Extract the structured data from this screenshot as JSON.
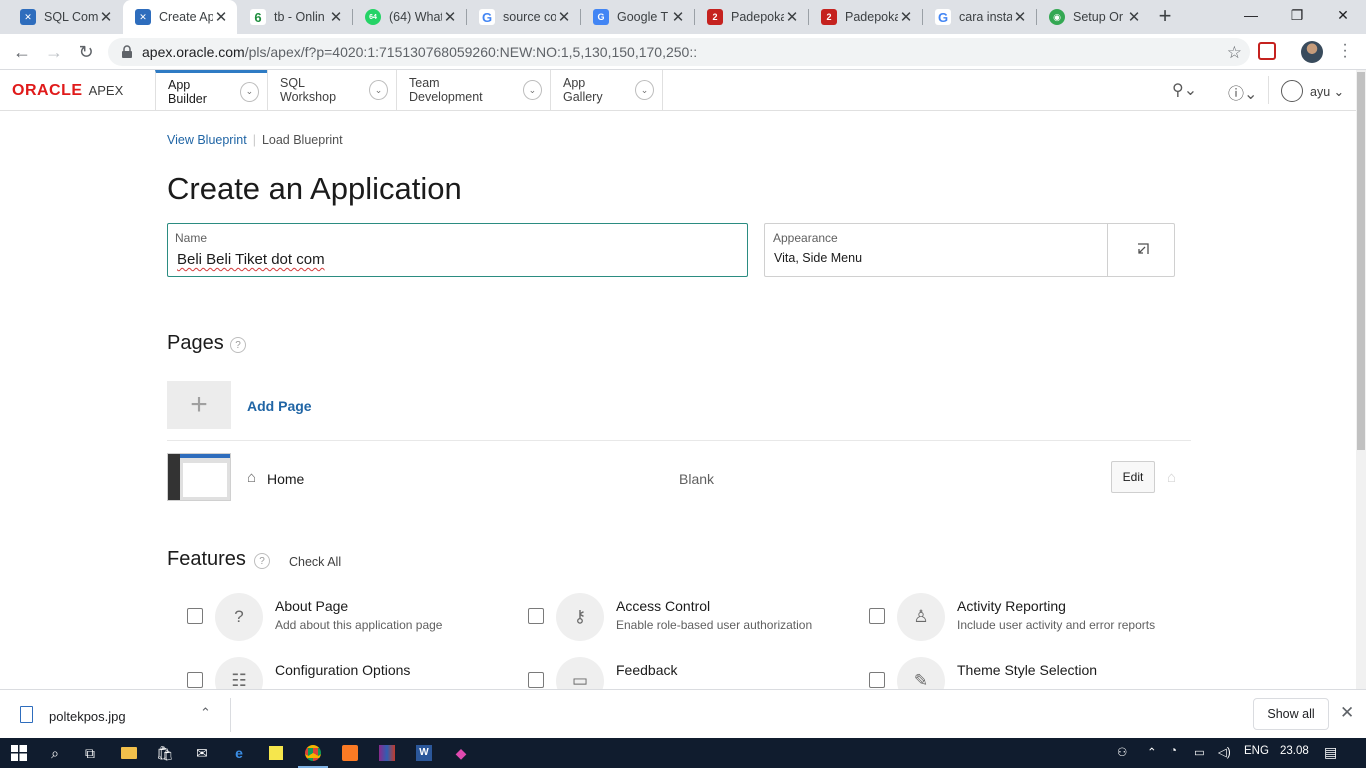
{
  "browser": {
    "tabs": [
      {
        "title": "SQL Com",
        "favicon": "apex-icon",
        "color": "#2e6dbd",
        "glyph": "✕"
      },
      {
        "title": "Create Ap",
        "favicon": "apex-icon",
        "color": "#2e6dbd",
        "glyph": "✕"
      },
      {
        "title": "tb - Onlin",
        "favicon": "leaf-icon",
        "color": "#1e8e3e",
        "glyph": "6"
      },
      {
        "title": "(64) What",
        "favicon": "whatsapp-icon",
        "color": "#25d366",
        "glyph": "64"
      },
      {
        "title": "source co",
        "favicon": "google-icon",
        "color": "#4285f4",
        "glyph": "G"
      },
      {
        "title": "Google T",
        "favicon": "translate-icon",
        "color": "#4285f4",
        "glyph": "G"
      },
      {
        "title": "Padepoka",
        "favicon": "padepokan-icon",
        "color": "#c5221f",
        "glyph": "2"
      },
      {
        "title": "Padepoka",
        "favicon": "padepokan-icon",
        "color": "#c5221f",
        "glyph": "2"
      },
      {
        "title": "cara insta",
        "favicon": "google-icon",
        "color": "#4285f4",
        "glyph": "G"
      },
      {
        "title": "Setup Or",
        "favicon": "globe-icon",
        "color": "#34a853",
        "glyph": "◉"
      }
    ],
    "url_host": "apex.oracle.com",
    "url_path": "/pls/apex/f?p=4020:1:715130768059260:NEW:NO:1,5,130,150,170,250::"
  },
  "apex_header": {
    "logo_oracle": "ORACLE",
    "logo_apex": "APEX",
    "menus": [
      "App Builder",
      "SQL Workshop",
      "Team Development",
      "App Gallery"
    ],
    "user": "ayu"
  },
  "breadcrumbs": {
    "view_blueprint": "View Blueprint",
    "load_blueprint": "Load Blueprint"
  },
  "page": {
    "title": "Create an Application",
    "name_label": "Name",
    "name_value": "Beli Beli Tiket dot com",
    "appearance_label": "Appearance",
    "appearance_value": "Vita, Side Menu"
  },
  "pages_section": {
    "title": "Pages",
    "help": "?",
    "add_page": "Add Page",
    "items": [
      {
        "name": "Home",
        "type": "Blank",
        "edit": "Edit"
      }
    ]
  },
  "features_section": {
    "title": "Features",
    "help": "?",
    "check_all": "Check All",
    "items": [
      {
        "title": "About Page",
        "desc": "Add about this application page",
        "icon": "question-icon",
        "glyph": "?"
      },
      {
        "title": "Access Control",
        "desc": "Enable role-based user authorization",
        "icon": "key-icon",
        "glyph": "⚷"
      },
      {
        "title": "Activity Reporting",
        "desc": "Include user activity and error reports",
        "icon": "user-report-icon",
        "glyph": "👤"
      },
      {
        "title": "Configuration Options",
        "desc": "",
        "icon": "sliders-icon",
        "glyph": "☷"
      },
      {
        "title": "Feedback",
        "desc": "",
        "icon": "comment-icon",
        "glyph": "💬"
      },
      {
        "title": "Theme Style Selection",
        "desc": "",
        "icon": "brush-icon",
        "glyph": "✎"
      }
    ]
  },
  "downloads": {
    "file": "poltekpos.jpg",
    "show_all": "Show all"
  },
  "taskbar": {
    "lang": "ENG",
    "time": "23.08"
  }
}
